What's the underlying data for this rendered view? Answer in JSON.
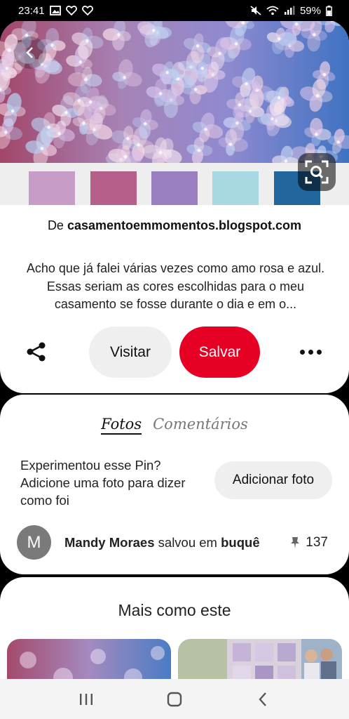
{
  "status_bar": {
    "time": "23:41",
    "battery": "59%",
    "left_icons": [
      "gallery-icon",
      "heart-icon",
      "heart-icon"
    ],
    "right_icons": [
      "mute-icon",
      "wifi-icon",
      "signal-icon",
      "battery-icon"
    ]
  },
  "pin": {
    "palette": [
      "#c79cc6",
      "#b65f8a",
      "#9a80c0",
      "#a8d8e2",
      "#22669e"
    ],
    "source_prefix": "De",
    "source_domain": "casamentoemmomentos.blogspot.com",
    "description": "Acho que já falei várias vezes como amo rosa e azul.   Essas seriam as cores escolhidas para o meu casamento se fosse durante o dia e em o...",
    "visit_label": "Visitar",
    "save_label": "Salvar"
  },
  "photos": {
    "tabs": [
      "Fotos",
      "Comentários"
    ],
    "prompt": "Experimentou esse Pin? Adicione uma foto para dizer como foi",
    "add_photo_label": "Adicionar foto",
    "saver": {
      "avatar_letter": "M",
      "name": "Mandy Moraes",
      "action": "salvou em",
      "board": "buquê",
      "pin_count": "137"
    }
  },
  "more": {
    "title": "Mais como este"
  },
  "colors": {
    "accent": "#e60023"
  }
}
